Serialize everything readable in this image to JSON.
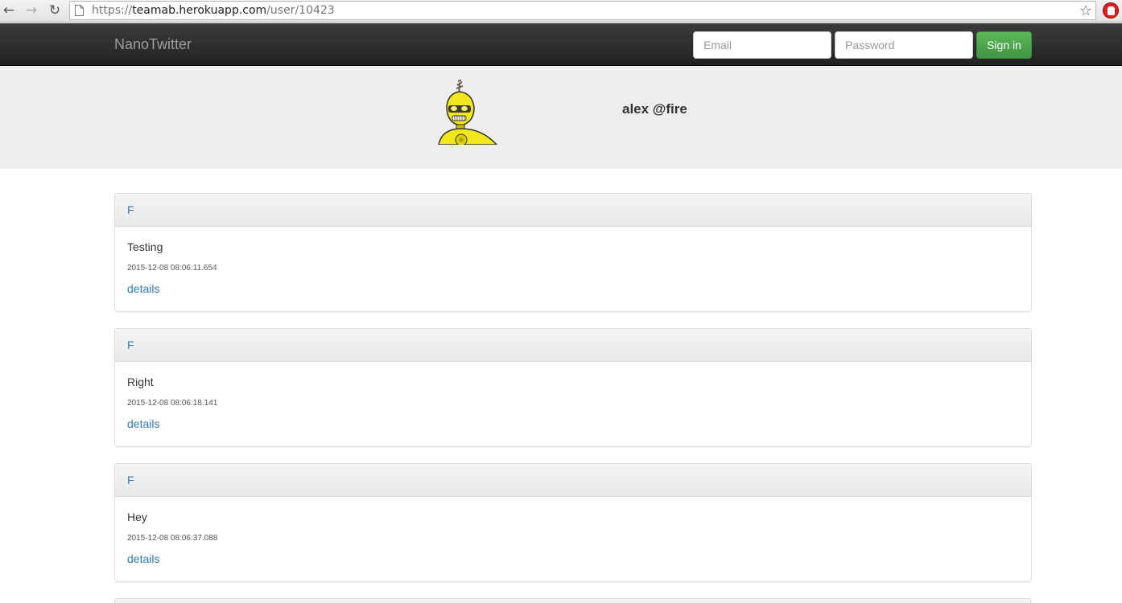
{
  "browser": {
    "url_scheme": "https://",
    "url_host": "teamab.herokuapp.com",
    "url_path": "/user/10423"
  },
  "navbar": {
    "brand": "NanoTwitter",
    "email_placeholder": "Email",
    "password_placeholder": "Password",
    "signin_label": "Sign in"
  },
  "profile": {
    "name": "alex @fire"
  },
  "posts": [
    {
      "author": "F",
      "text": "Testing",
      "timestamp": "2015-12-08 08:06:11.654",
      "link": "details"
    },
    {
      "author": "F",
      "text": "Right",
      "timestamp": "2015-12-08 08:06:18.141",
      "link": "details"
    },
    {
      "author": "F",
      "text": "Hey",
      "timestamp": "2015-12-08 08:06:37.088",
      "link": "details"
    }
  ],
  "colors": {
    "navbar_bg": "#222222",
    "link": "#337ab7",
    "signin_green": "#5cb85c",
    "header_bg": "#eeeeee"
  }
}
